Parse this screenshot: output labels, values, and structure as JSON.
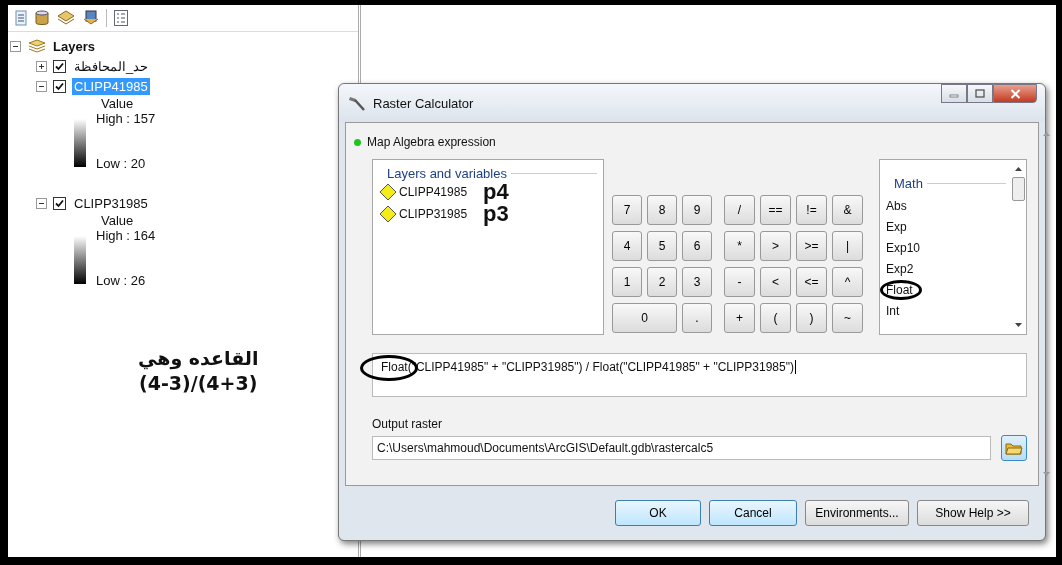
{
  "toc": {
    "root": {
      "label": "Layers",
      "expanded": true,
      "children": [
        {
          "label": "حد_المحافظة",
          "checked": true,
          "expanded": false,
          "selected": false
        },
        {
          "label": "CLIPP41985",
          "checked": true,
          "expanded": true,
          "selected": true,
          "legend": {
            "heading": "Value",
            "high": "High : 157",
            "low": "Low : 20"
          }
        },
        {
          "label": "CLIPP31985",
          "checked": true,
          "expanded": true,
          "selected": false,
          "legend": {
            "heading": "Value",
            "high": "High : 164",
            "low": "Low : 26"
          }
        }
      ]
    }
  },
  "note": {
    "title": "القاعده وهي",
    "formula": "(4-3)/(4+3)"
  },
  "dialog": {
    "title": "Raster Calculator",
    "section": "Map Algebra expression",
    "layers_heading": "Layers and variables",
    "variables": [
      {
        "name": "CLIPP41985",
        "note": "p4"
      },
      {
        "name": "CLIPP31985",
        "note": "p3"
      }
    ],
    "digits": [
      {
        "label": "7",
        "wide": false
      },
      {
        "label": "8",
        "wide": false
      },
      {
        "label": "9",
        "wide": false
      },
      {
        "label": "4",
        "wide": false
      },
      {
        "label": "5",
        "wide": false
      },
      {
        "label": "6",
        "wide": false
      },
      {
        "label": "1",
        "wide": false
      },
      {
        "label": "2",
        "wide": false
      },
      {
        "label": "3",
        "wide": false
      },
      {
        "label": "0",
        "wide": true
      },
      {
        "label": ".",
        "wide": false
      }
    ],
    "operators": [
      "/",
      "==",
      "!=",
      "&",
      "*",
      ">",
      ">=",
      "|",
      "-",
      "<",
      "<=",
      "^",
      "+",
      "(",
      ")",
      "~"
    ],
    "functions": {
      "group": "Math",
      "items": [
        {
          "label": "Abs",
          "circled": false
        },
        {
          "label": "Exp",
          "circled": false
        },
        {
          "label": "Exp10",
          "circled": false
        },
        {
          "label": "Exp2",
          "circled": false
        },
        {
          "label": "Float",
          "circled": true
        },
        {
          "label": "Int",
          "circled": false
        }
      ]
    },
    "expression": {
      "value": "Float(\"CLIPP41985\" + \"CLIPP31985\") / Float(\"CLIPP41985\" + \"CLIPP31985\")",
      "circled": true
    },
    "output_label": "Output raster",
    "output_value": "C:\\Users\\mahmoud\\Documents\\ArcGIS\\Default.gdb\\rastercalc5",
    "buttons": [
      {
        "label": "OK",
        "highlighted": true
      },
      {
        "label": "Cancel",
        "highlighted": true
      },
      {
        "label": "Environments...",
        "highlighted": false
      },
      {
        "label": "Show Help >>",
        "highlighted": false
      }
    ]
  }
}
